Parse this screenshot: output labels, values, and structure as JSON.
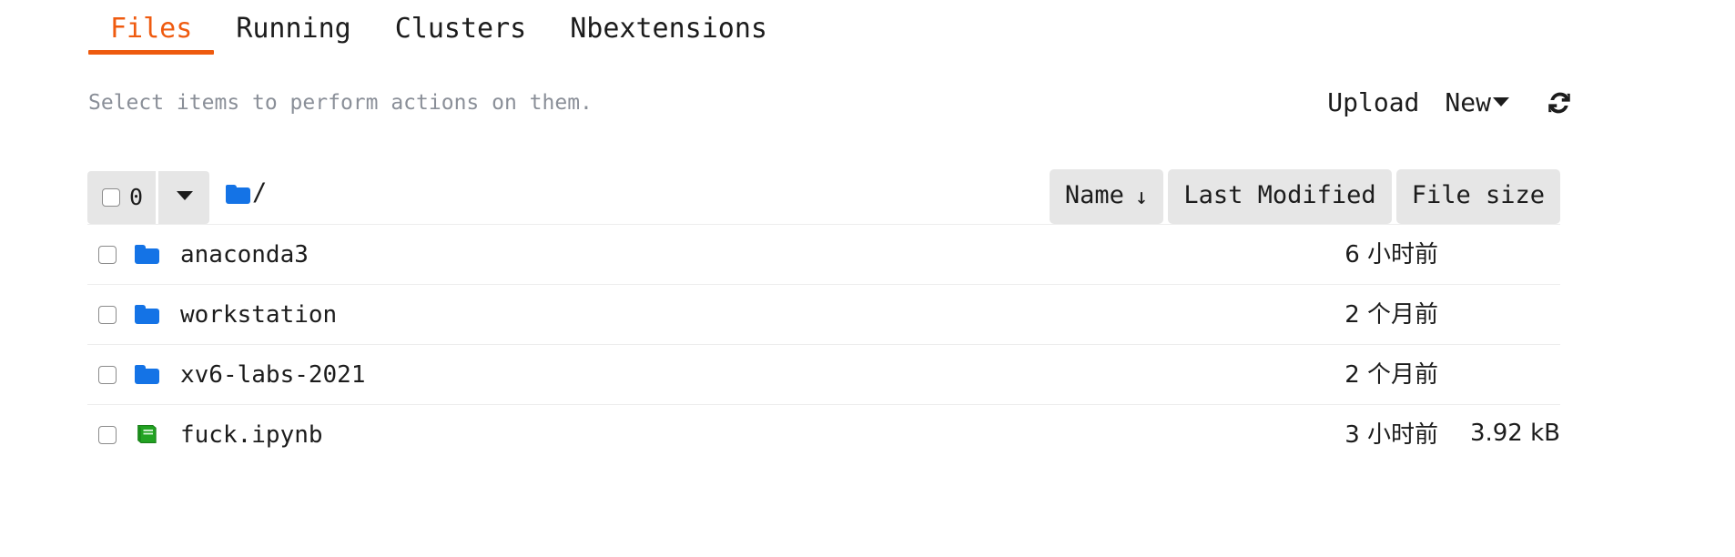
{
  "tabs": [
    {
      "label": "Files",
      "active": true
    },
    {
      "label": "Running",
      "active": false
    },
    {
      "label": "Clusters",
      "active": false
    },
    {
      "label": "Nbextensions",
      "active": false
    }
  ],
  "toolbar": {
    "hint": "Select items to perform actions on them.",
    "upload_label": "Upload",
    "new_label": "New",
    "refresh_icon": "refresh-icon",
    "caret_icon": "chevron-down-icon"
  },
  "selector": {
    "selected_count": "0",
    "dropdown_icon": "chevron-down-icon"
  },
  "breadcrumb": {
    "root_icon": "folder-icon",
    "separator": "/"
  },
  "columns": [
    {
      "label": "Name",
      "sort_icon": "↓",
      "sorted": true
    },
    {
      "label": "Last Modified",
      "sort_icon": "",
      "sorted": false
    },
    {
      "label": "File size",
      "sort_icon": "",
      "sorted": false
    }
  ],
  "files": [
    {
      "name": "anaconda3",
      "icon": "folder-icon",
      "type": "folder",
      "modified": "6 小时前",
      "size": ""
    },
    {
      "name": "workstation",
      "icon": "folder-icon",
      "type": "folder",
      "modified": "2 个月前",
      "size": ""
    },
    {
      "name": "xv6-labs-2021",
      "icon": "folder-icon",
      "type": "folder",
      "modified": "2 个月前",
      "size": ""
    },
    {
      "name": "fuck.ipynb",
      "icon": "notebook-icon",
      "type": "notebook",
      "modified": "3 小时前",
      "size": "3.92 kB"
    }
  ],
  "colors": {
    "accent_orange": "#ee5a0e",
    "folder_blue": "#1473e6",
    "notebook_green": "#22a322",
    "header_grey": "#e6e6e6",
    "hint_grey": "#8a8f98",
    "row_divider": "#ededed"
  }
}
